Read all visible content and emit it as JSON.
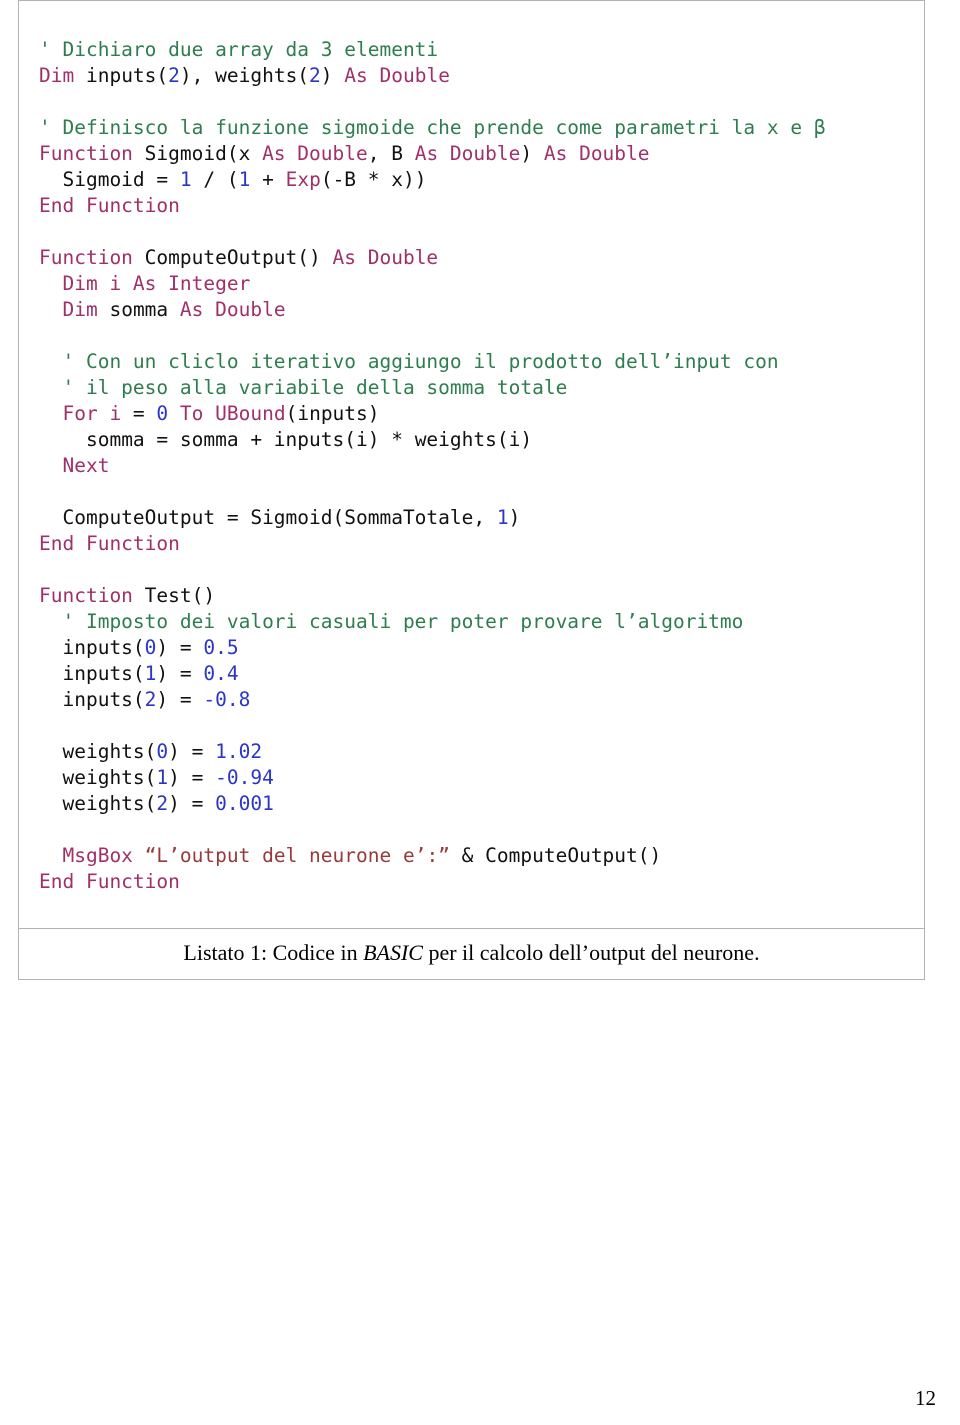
{
  "document": {
    "page_number": "12",
    "caption": {
      "prefix": "Listato 1: Codice in ",
      "emphasis": "BASIC",
      "suffix": " per il calcolo dell’output del neurone."
    }
  },
  "code_listing": {
    "language": "BASIC",
    "lines": [
      {
        "index": 1,
        "indent": 0,
        "tokens": [
          {
            "t": "' Dichiaro due array da 3 elementi",
            "c": "cmt"
          }
        ]
      },
      {
        "index": 2,
        "indent": 0,
        "tokens": [
          {
            "t": "Dim",
            "c": "kw"
          },
          {
            "t": " inputs(",
            "c": "id"
          },
          {
            "t": "2",
            "c": "num"
          },
          {
            "t": "), weights(",
            "c": "id"
          },
          {
            "t": "2",
            "c": "num"
          },
          {
            "t": ") ",
            "c": "id"
          },
          {
            "t": "As Double",
            "c": "kw"
          }
        ]
      },
      {
        "index": 3,
        "indent": 0,
        "tokens": []
      },
      {
        "index": 4,
        "indent": 0,
        "tokens": [
          {
            "t": "' Definisco la funzione sigmoide che prende come parametri la x e β",
            "c": "cmt"
          }
        ]
      },
      {
        "index": 5,
        "indent": 0,
        "tokens": [
          {
            "t": "Function",
            "c": "kw"
          },
          {
            "t": " Sigmoid(x ",
            "c": "id"
          },
          {
            "t": "As Double",
            "c": "kw"
          },
          {
            "t": ", B ",
            "c": "id"
          },
          {
            "t": "As Double",
            "c": "kw"
          },
          {
            "t": ") ",
            "c": "id"
          },
          {
            "t": "As Double",
            "c": "kw"
          }
        ]
      },
      {
        "index": 6,
        "indent": 1,
        "tokens": [
          {
            "t": "Sigmoid = ",
            "c": "id"
          },
          {
            "t": "1",
            "c": "num"
          },
          {
            "t": " / (",
            "c": "id"
          },
          {
            "t": "1",
            "c": "num"
          },
          {
            "t": " + ",
            "c": "id"
          },
          {
            "t": "Exp",
            "c": "kw"
          },
          {
            "t": "(-B * x))",
            "c": "id"
          }
        ]
      },
      {
        "index": 7,
        "indent": 0,
        "tokens": [
          {
            "t": "End Function",
            "c": "kw"
          }
        ]
      },
      {
        "index": 8,
        "indent": 0,
        "tokens": []
      },
      {
        "index": 9,
        "indent": 0,
        "tokens": [
          {
            "t": "Function",
            "c": "kw"
          },
          {
            "t": " ComputeOutput() ",
            "c": "id"
          },
          {
            "t": "As Double",
            "c": "kw"
          }
        ]
      },
      {
        "index": 10,
        "indent": 1,
        "tokens": [
          {
            "t": "Dim i As Integer",
            "c": "kw"
          }
        ]
      },
      {
        "index": 11,
        "indent": 1,
        "tokens": [
          {
            "t": "Dim",
            "c": "kw"
          },
          {
            "t": " somma ",
            "c": "id"
          },
          {
            "t": "As Double",
            "c": "kw"
          }
        ]
      },
      {
        "index": 12,
        "indent": 0,
        "tokens": []
      },
      {
        "index": 13,
        "indent": 1,
        "tokens": [
          {
            "t": "' Con un cliclo iterativo aggiungo il prodotto dell’input con",
            "c": "cmt"
          }
        ]
      },
      {
        "index": 14,
        "indent": 1,
        "tokens": [
          {
            "t": "' il peso alla variabile della somma totale",
            "c": "cmt"
          }
        ]
      },
      {
        "index": 15,
        "indent": 1,
        "tokens": [
          {
            "t": "For i",
            "c": "kw"
          },
          {
            "t": " = ",
            "c": "id"
          },
          {
            "t": "0",
            "c": "num"
          },
          {
            "t": " ",
            "c": "id"
          },
          {
            "t": "To UBound",
            "c": "kw"
          },
          {
            "t": "(inputs)",
            "c": "id"
          }
        ]
      },
      {
        "index": 16,
        "indent": 2,
        "tokens": [
          {
            "t": "somma = somma + inputs(i) * weights(i)",
            "c": "id"
          }
        ]
      },
      {
        "index": 17,
        "indent": 1,
        "tokens": [
          {
            "t": "Next",
            "c": "kw"
          }
        ]
      },
      {
        "index": 18,
        "indent": 0,
        "tokens": []
      },
      {
        "index": 19,
        "indent": 1,
        "tokens": [
          {
            "t": "ComputeOutput = Sigmoid(SommaTotale, ",
            "c": "id"
          },
          {
            "t": "1",
            "c": "num"
          },
          {
            "t": ")",
            "c": "id"
          }
        ]
      },
      {
        "index": 20,
        "indent": 0,
        "tokens": [
          {
            "t": "End Function",
            "c": "kw"
          }
        ]
      },
      {
        "index": 21,
        "indent": 0,
        "tokens": []
      },
      {
        "index": 22,
        "indent": 0,
        "tokens": [
          {
            "t": "Function",
            "c": "kw"
          },
          {
            "t": " Test()",
            "c": "id"
          }
        ]
      },
      {
        "index": 23,
        "indent": 1,
        "tokens": [
          {
            "t": "' Imposto dei valori casuali per poter provare l’algoritmo",
            "c": "cmt"
          }
        ]
      },
      {
        "index": 24,
        "indent": 1,
        "tokens": [
          {
            "t": "inputs(",
            "c": "id"
          },
          {
            "t": "0",
            "c": "num"
          },
          {
            "t": ") = ",
            "c": "id"
          },
          {
            "t": "0.5",
            "c": "num"
          }
        ]
      },
      {
        "index": 25,
        "indent": 1,
        "tokens": [
          {
            "t": "inputs(",
            "c": "id"
          },
          {
            "t": "1",
            "c": "num"
          },
          {
            "t": ") = ",
            "c": "id"
          },
          {
            "t": "0.4",
            "c": "num"
          }
        ]
      },
      {
        "index": 26,
        "indent": 1,
        "tokens": [
          {
            "t": "inputs(",
            "c": "id"
          },
          {
            "t": "2",
            "c": "num"
          },
          {
            "t": ") = ",
            "c": "id"
          },
          {
            "t": "-0.8",
            "c": "num"
          }
        ]
      },
      {
        "index": 27,
        "indent": 0,
        "tokens": []
      },
      {
        "index": 28,
        "indent": 1,
        "tokens": [
          {
            "t": "weights(",
            "c": "id"
          },
          {
            "t": "0",
            "c": "num"
          },
          {
            "t": ") = ",
            "c": "id"
          },
          {
            "t": "1.02",
            "c": "num"
          }
        ]
      },
      {
        "index": 29,
        "indent": 1,
        "tokens": [
          {
            "t": "weights(",
            "c": "id"
          },
          {
            "t": "1",
            "c": "num"
          },
          {
            "t": ") = ",
            "c": "id"
          },
          {
            "t": "-0.94",
            "c": "num"
          }
        ]
      },
      {
        "index": 30,
        "indent": 1,
        "tokens": [
          {
            "t": "weights(",
            "c": "id"
          },
          {
            "t": "2",
            "c": "num"
          },
          {
            "t": ") = ",
            "c": "id"
          },
          {
            "t": "0.001",
            "c": "num"
          }
        ]
      },
      {
        "index": 31,
        "indent": 0,
        "tokens": []
      },
      {
        "index": 32,
        "indent": 1,
        "tokens": [
          {
            "t": "MsgBox",
            "c": "kw"
          },
          {
            "t": " ",
            "c": "id"
          },
          {
            "t": "“L’output del neurone e’:”",
            "c": "str"
          },
          {
            "t": " & ComputeOutput()",
            "c": "id"
          }
        ]
      },
      {
        "index": 33,
        "indent": 0,
        "tokens": [
          {
            "t": "End Function",
            "c": "kw"
          }
        ]
      }
    ],
    "colors": {
      "keyword": "#a0306a",
      "comment": "#2e7d4f",
      "number": "#2b35c8",
      "string": "#963a3a",
      "identifier": "#111111",
      "border": "#b3b3b3",
      "background": "#ffffff"
    }
  }
}
